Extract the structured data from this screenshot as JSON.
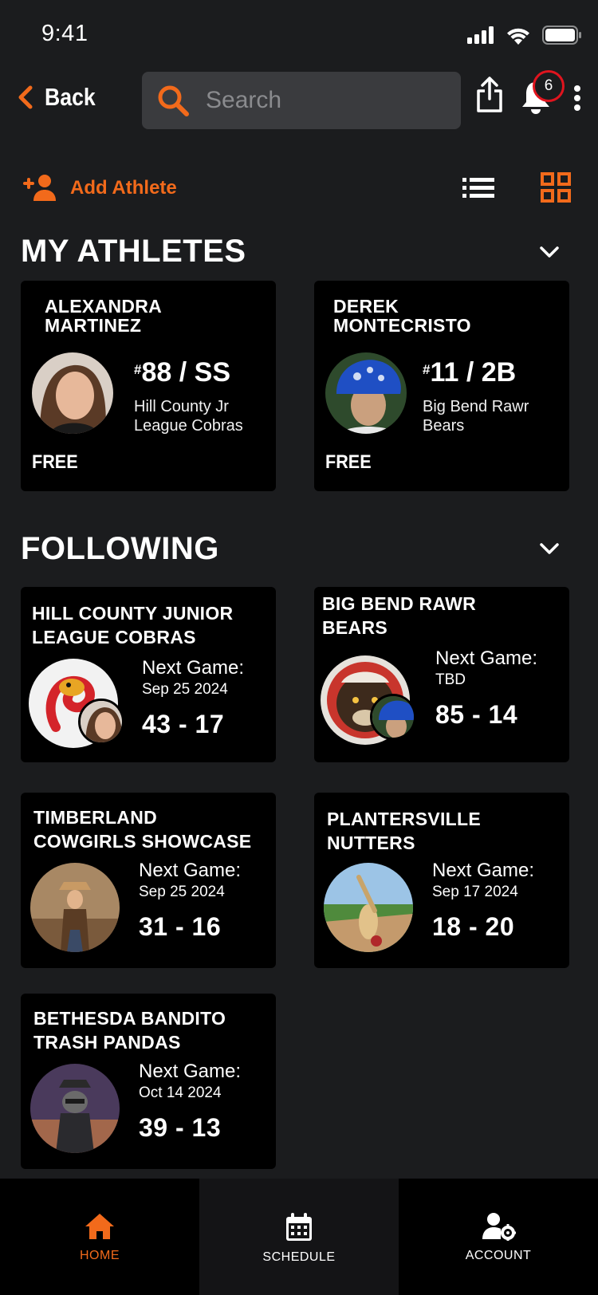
{
  "status_bar": {
    "time": "9:41"
  },
  "header": {
    "back_label": "Back",
    "search_placeholder": "Search",
    "notification_count": "6"
  },
  "actions": {
    "add_athlete_label": "Add Athlete"
  },
  "my_athletes": {
    "title": "MY ATHLETES",
    "items": [
      {
        "name": "ALEXANDRA MARTINEZ",
        "name_line1": "ALEXANDRA",
        "name_line2": "MARTINEZ",
        "number": "88",
        "position": " / SS",
        "team_line1": "Hill County Jr",
        "team_line2": "League Cobras",
        "plan": "FREE"
      },
      {
        "name": "DEREK MONTECRISTO",
        "name_line1": "DEREK",
        "name_line2": "MONTECRISTO",
        "number": "11",
        "position": " / 2B",
        "team_line1": "Big Bend Rawr",
        "team_line2": "Bears",
        "plan": "FREE"
      }
    ]
  },
  "following": {
    "title": "FOLLOWING",
    "next_game_label": "Next Game:",
    "items": [
      {
        "line1": "HILL COUNTY JUNIOR",
        "line2": "LEAGUE COBRAS",
        "date": "Sep 25 2024",
        "record": "43 - 17"
      },
      {
        "line1": "BIG BEND RAWR",
        "line2": "BEARS",
        "date": "TBD",
        "record": "85 - 14"
      },
      {
        "line1": "TIMBERLAND",
        "line2": "COWGIRLS SHOWCASE",
        "date": "Sep 25 2024",
        "record": "31 - 16"
      },
      {
        "line1": "PLANTERSVILLE",
        "line2": "NUTTERS",
        "date": "Sep 17 2024",
        "record": "18 - 20"
      },
      {
        "line1": "BETHESDA BANDITO",
        "line2": "TRASH PANDAS",
        "date": "Oct 14 2024",
        "record": "39 - 13"
      }
    ]
  },
  "bottom_nav": {
    "home": "HOME",
    "schedule": "SCHEDULE",
    "account": "ACCOUNT"
  },
  "colors": {
    "accent": "#f26a1b",
    "background": "#1b1c1e",
    "card": "#000000",
    "badge_ring": "#e0141e"
  },
  "icons": [
    "signal-icon",
    "wifi-icon",
    "battery-icon",
    "back-chevron-icon",
    "search-icon",
    "share-icon",
    "bell-icon",
    "kebab-icon",
    "add-person-icon",
    "list-view-icon",
    "grid-view-icon",
    "chevron-down-icon",
    "home-icon",
    "calendar-icon",
    "account-settings-icon"
  ]
}
